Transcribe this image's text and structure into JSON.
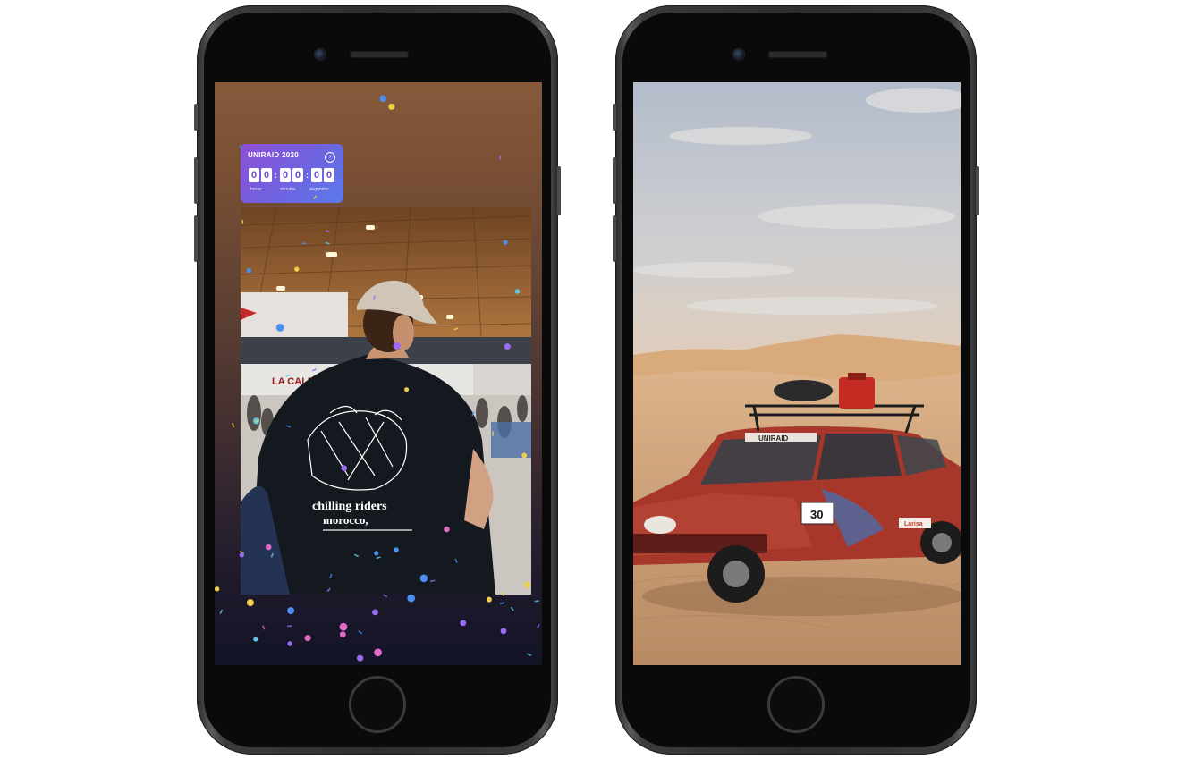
{
  "left_phone": {
    "countdown_sticker": {
      "title": "UNIRAID 2020",
      "hours": [
        "0",
        "0"
      ],
      "minutes": [
        "0",
        "0"
      ],
      "seconds": [
        "0",
        "0"
      ],
      "labels": [
        "horas",
        "minutos",
        "segundos"
      ],
      "accent_start": "#8e4fd6",
      "accent_end": "#5a7bea"
    },
    "photo_shirt_text": {
      "line1": "chilling riders",
      "line2": "morocco,"
    }
  },
  "right_phone": {
    "car_banner": "UNIRAID",
    "car_number": "30",
    "sponsor": "Larisa"
  },
  "colors": {
    "phone_body": "#2e2e30",
    "screen_bezel": "#0a0a0a",
    "confetti": [
      "#9b6bf2",
      "#4a8ef0",
      "#f2cf4a",
      "#e06ac6",
      "#5fc9e6"
    ]
  }
}
